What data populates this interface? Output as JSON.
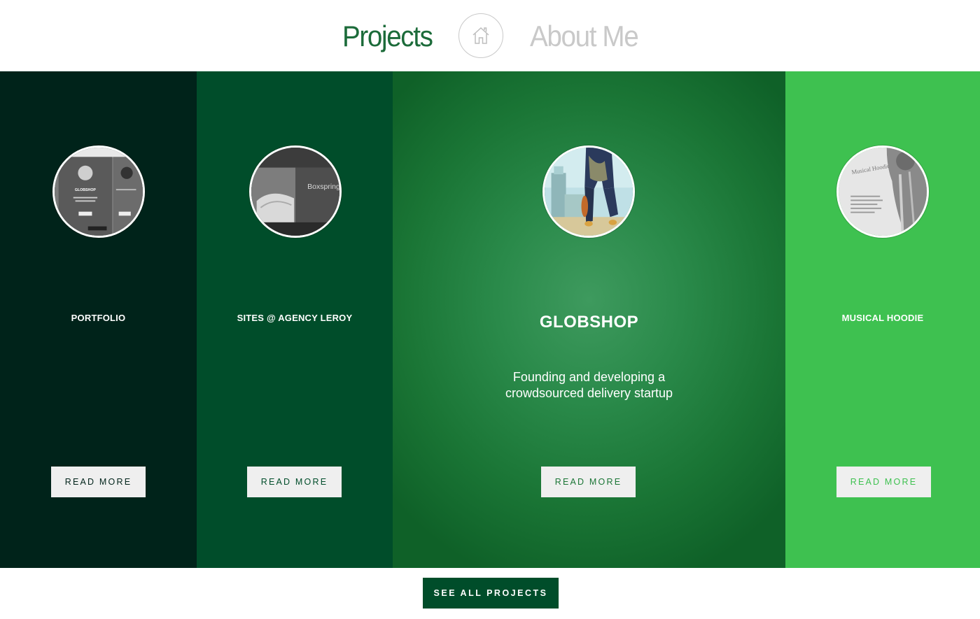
{
  "nav": {
    "projects_label": "Projects",
    "about_label": "About Me",
    "home_icon": "home-icon"
  },
  "projects": [
    {
      "title": "PORTFOLIO",
      "description": "",
      "button_label": "READ MORE",
      "panel_color": "#00231a",
      "button_text_color": "#00231a"
    },
    {
      "title": "SITES @ AGENCY LEROY",
      "description": "",
      "button_label": "READ MORE",
      "panel_color": "#004d2a",
      "button_text_color": "#004d2a"
    },
    {
      "title": "GLOBSHOP",
      "description": "Founding and developing a crowdsourced delivery startup",
      "button_label": "READ MORE",
      "panel_color": "#1a7535",
      "button_text_color": "#1a7535"
    },
    {
      "title": "MUSICAL HOODIE",
      "description": "",
      "button_label": "READ MORE",
      "panel_color": "#3ec150",
      "button_text_color": "#3ec150"
    }
  ],
  "thumbnails": {
    "portfolio": {
      "heading": "GLOBSHOP"
    },
    "leroy": {
      "text": "Boxspring aus der Ma"
    },
    "hoodie": {
      "heading": "Musical Hoodie"
    }
  },
  "footer": {
    "see_all_label": "SEE ALL PROJECTS"
  },
  "colors": {
    "accent": "#004d2a",
    "nav_active": "#1c6b3a",
    "nav_inactive": "#c9c9c9"
  }
}
